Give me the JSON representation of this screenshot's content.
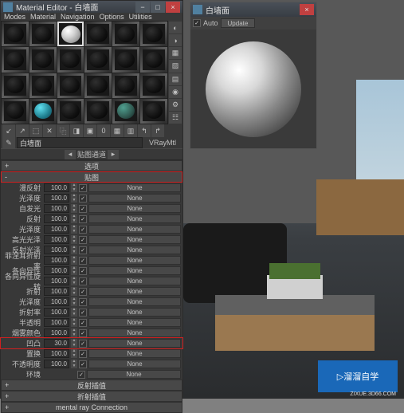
{
  "scene": {
    "watermark_text": "溜溜自学",
    "watermark_url": "ZIXUE.3D66.COM"
  },
  "editor": {
    "title": "Material Editor - 白墙面",
    "menus": [
      "Modes",
      "Material",
      "Navigation",
      "Options",
      "Utilities"
    ],
    "material_name": "白墙面",
    "material_type": "VRayMtl",
    "channel_label": "贴图通道",
    "rollouts": {
      "options": "选项",
      "maps": "贴图",
      "refl_interp": "反射插值",
      "refr_interp": "折射插值",
      "mental": "mental ray Connection"
    },
    "maps": [
      {
        "label": "漫反射",
        "value": "100.0",
        "checked": true,
        "slot": "None"
      },
      {
        "label": "光泽度",
        "value": "100.0",
        "checked": true,
        "slot": "None"
      },
      {
        "label": "自发光",
        "value": "100.0",
        "checked": true,
        "slot": "None"
      },
      {
        "label": "反射",
        "value": "100.0",
        "checked": true,
        "slot": "None"
      },
      {
        "label": "光泽度",
        "value": "100.0",
        "checked": true,
        "slot": "None"
      },
      {
        "label": "高光光泽",
        "value": "100.0",
        "checked": true,
        "slot": "None"
      },
      {
        "label": "反射光泽",
        "value": "100.0",
        "checked": true,
        "slot": "None"
      },
      {
        "label": "菲涅耳折射率",
        "value": "100.0",
        "checked": true,
        "slot": "None"
      },
      {
        "label": "各向异性",
        "value": "100.0",
        "checked": true,
        "slot": "None"
      },
      {
        "label": "各向异性旋转",
        "value": "100.0",
        "checked": true,
        "slot": "None"
      },
      {
        "label": "折射",
        "value": "100.0",
        "checked": true,
        "slot": "None"
      },
      {
        "label": "光泽度",
        "value": "100.0",
        "checked": true,
        "slot": "None"
      },
      {
        "label": "折射率",
        "value": "100.0",
        "checked": true,
        "slot": "None"
      },
      {
        "label": "半透明",
        "value": "100.0",
        "checked": true,
        "slot": "None"
      },
      {
        "label": "烟雾颜色",
        "value": "100.0",
        "checked": true,
        "slot": "None"
      },
      {
        "label": "凹凸",
        "value": "30.0",
        "checked": true,
        "slot": "None",
        "highlight": true
      },
      {
        "label": "置换",
        "value": "100.0",
        "checked": true,
        "slot": "None"
      },
      {
        "label": "不透明度",
        "value": "100.0",
        "checked": true,
        "slot": "None"
      },
      {
        "label": "环境",
        "value": "",
        "checked": true,
        "slot": "None"
      }
    ]
  },
  "preview": {
    "title": "白墙面",
    "auto_label": "Auto",
    "update_label": "Update"
  }
}
